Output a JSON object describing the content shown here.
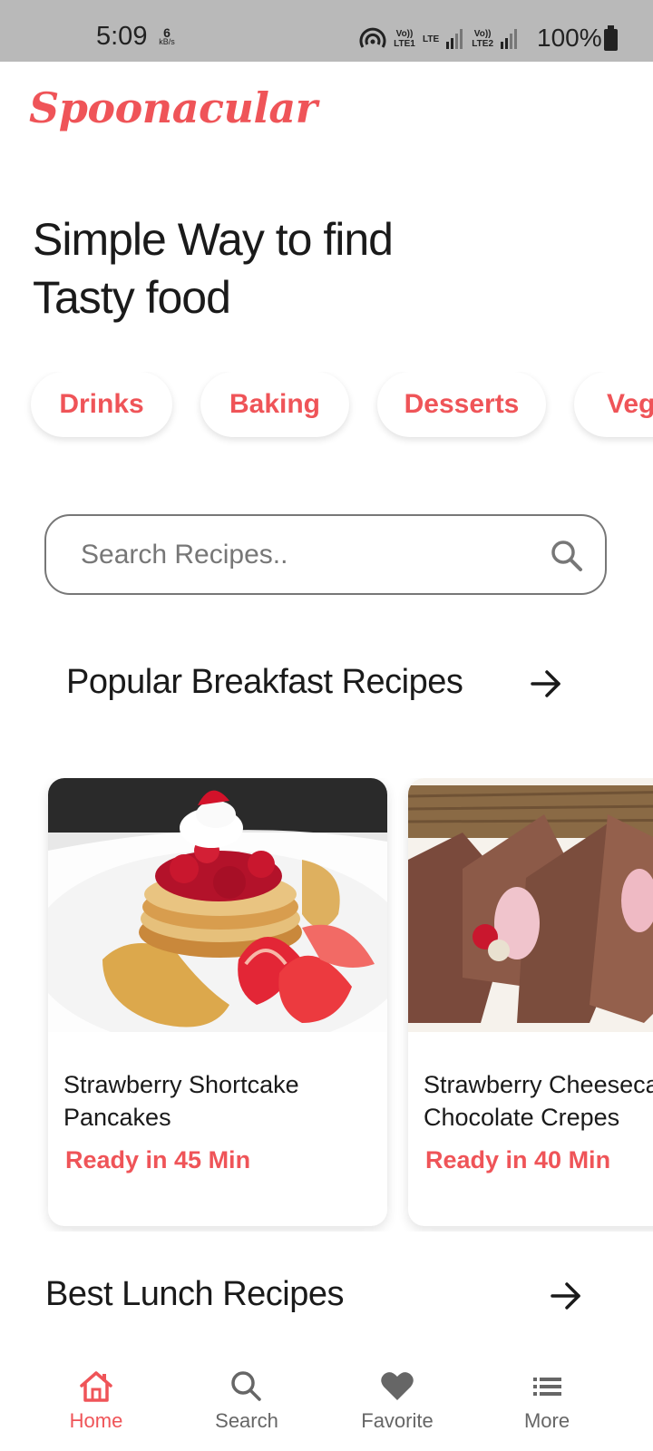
{
  "status_bar": {
    "time": "5:09",
    "speed_value": "6",
    "speed_unit": "kB/s",
    "sim1": "Vo)) LTE1",
    "sim1_net": "LTE",
    "sim2": "Vo)) LTE2",
    "battery": "100%"
  },
  "app": {
    "logo": "Spoonacular",
    "headline_line1": "Simple Way to find",
    "headline_line2": "Tasty food"
  },
  "categories": [
    "Drinks",
    "Baking",
    "Desserts",
    "Veg"
  ],
  "search": {
    "placeholder": "Search Recipes.."
  },
  "sections": {
    "breakfast_title": "Popular Breakfast Recipes",
    "lunch_title": "Best Lunch Recipes"
  },
  "recipes": [
    {
      "title": "Strawberry Shortcake Pancakes",
      "time": "Ready in 45 Min"
    },
    {
      "title": "Strawberry Cheesecake Chocolate Crepes",
      "time": "Ready in 40 Min"
    }
  ],
  "nav": {
    "home": "Home",
    "search": "Search",
    "favorite": "Favorite",
    "more": "More"
  },
  "colors": {
    "accent": "#ef5458",
    "status_bar": "#b9b9b9"
  }
}
